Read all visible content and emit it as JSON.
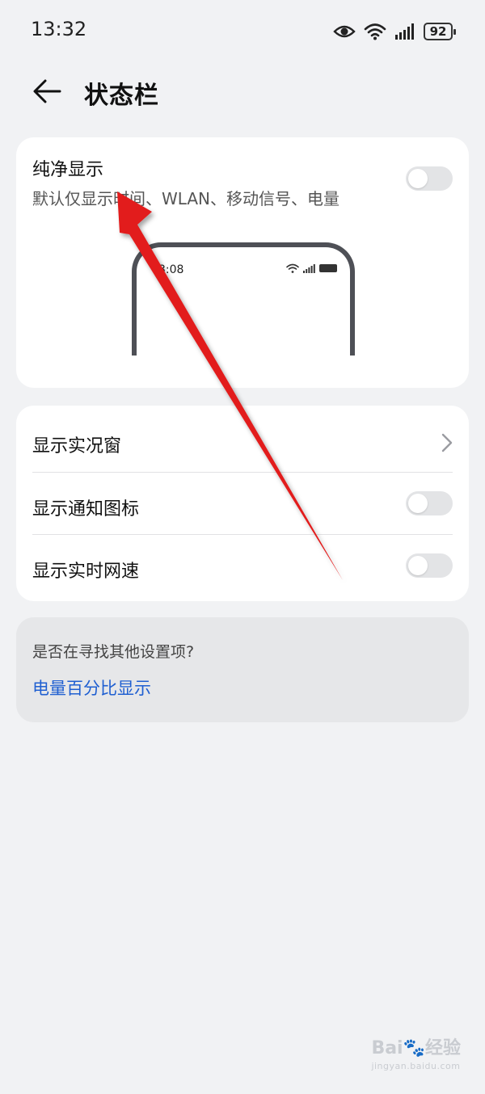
{
  "status_bar": {
    "time": "13:32",
    "battery": "92",
    "icons": [
      "eye-icon",
      "wifi-icon",
      "signal-icon",
      "battery-icon"
    ]
  },
  "header": {
    "title": "状态栏",
    "back_icon": "back-arrow-icon"
  },
  "clean_display": {
    "title": "纯净显示",
    "subtitle": "默认仅显示时间、WLAN、移动信号、电量",
    "toggle_on": false,
    "preview": {
      "time": "3:08",
      "icons": [
        "wifi-icon",
        "signal-icon",
        "battery-icon"
      ]
    }
  },
  "settings": [
    {
      "label": "显示实况窗",
      "control": "chevron"
    },
    {
      "label": "显示通知图标",
      "control": "toggle",
      "on": false
    },
    {
      "label": "显示实时网速",
      "control": "toggle",
      "on": false
    }
  ],
  "search_hint": {
    "question": "是否在寻找其他设置项?",
    "link": "电量百分比显示"
  },
  "colors": {
    "background": "#f1f2f4",
    "card": "#ffffff",
    "link": "#1f5fd1",
    "annotation_arrow": "#e21b1b"
  }
}
